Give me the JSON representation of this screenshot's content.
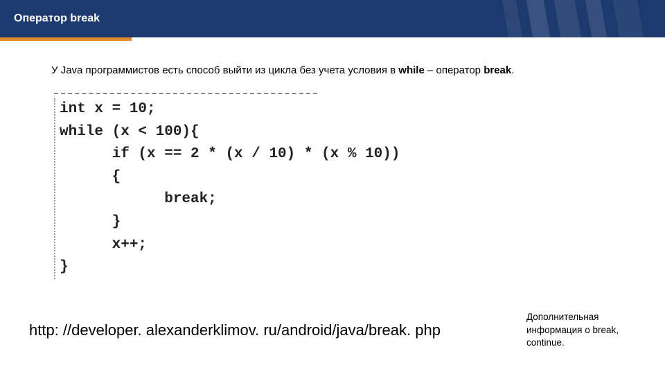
{
  "header": {
    "title": "Оператор break"
  },
  "intro": {
    "prefix": "У  Java программистов есть способ выйти из цикла без учета условия в ",
    "bold1": "while",
    "mid": " – оператор ",
    "bold2": "break",
    "suffix": "."
  },
  "code": {
    "line1": "int x = 10;",
    "line2": "while (x < 100){",
    "line3": "      if (x == 2 * (x / 10) * (x % 10))",
    "line4": "      {",
    "line5": "            break;",
    "line6": "      }",
    "line7": "      x++;",
    "line8": "}"
  },
  "footer": {
    "link": "http: //developer. alexanderklimov. ru/android/java/break. php",
    "extra": "Дополнительная информация о break, continue."
  }
}
